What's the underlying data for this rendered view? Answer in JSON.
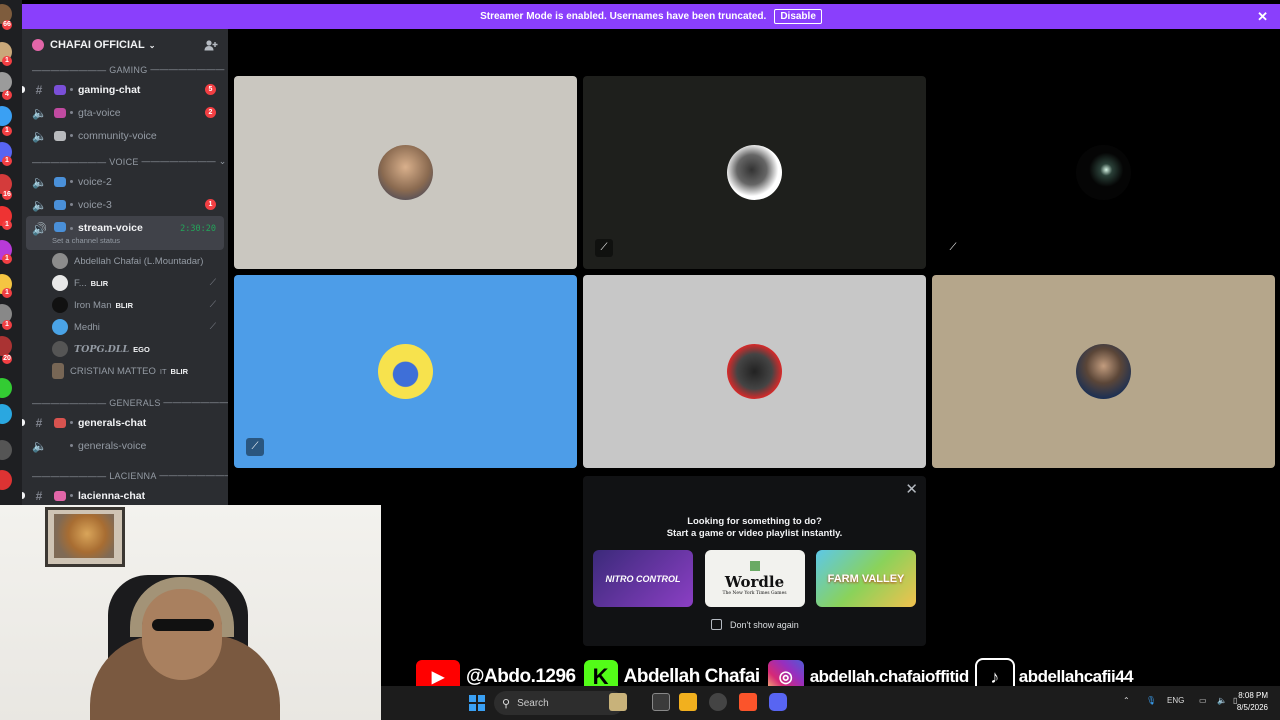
{
  "banner": {
    "message": "Streamer Mode is enabled. Usernames have been truncated.",
    "disable_label": "Disable",
    "close_label": "✕"
  },
  "server": {
    "name": "CHAFAI OFFICIAL",
    "chevron": "⌄",
    "invite_icon": "add-member-icon"
  },
  "rail_badges": [
    "66",
    "1",
    "4",
    "1",
    "1",
    "16",
    "1",
    "1",
    "1",
    "1",
    "1",
    "20",
    "9",
    "6",
    "5",
    "1",
    "4",
    "1"
  ],
  "categories": {
    "gaming": "GAMING",
    "voice": "VOICE",
    "generals": "GENERALS",
    "lacienna": "LACIENNA"
  },
  "channels": {
    "gaming_chat": {
      "name": "gaming-chat",
      "badge": "5"
    },
    "gta_voice": {
      "name": "gta-voice",
      "badge": "2"
    },
    "community_voice": {
      "name": "community-voice"
    },
    "voice_2": {
      "name": "voice-2"
    },
    "voice_3": {
      "name": "voice-3",
      "badge": "1"
    },
    "stream_voice": {
      "name": "stream-voice",
      "timer": "2:30:20",
      "status": "Set a channel status"
    },
    "generals_chat": {
      "name": "generals-chat"
    },
    "generals_voice": {
      "name": "generals-voice"
    },
    "lacienna_chat": {
      "name": "lacienna-chat"
    }
  },
  "members": [
    {
      "name": "Abdellah Chafai (L.Mountadar)",
      "tag": ""
    },
    {
      "name": "F...",
      "tag": "BLIR"
    },
    {
      "name": "Iron Man",
      "tag": "BLIR"
    },
    {
      "name": "Medhi",
      "tag": ""
    },
    {
      "name": "TOPG.DLL",
      "tag": "EGO"
    },
    {
      "name": "CRISTIAN MATTEO",
      "tag": "BLIR",
      "suffix": "IT"
    }
  ],
  "activity": {
    "title_line1": "Looking for something to do?",
    "title_line2": "Start a game or video playlist instantly.",
    "cards": [
      "NITRO CONTROL",
      "Wordle",
      "FARM VALLEY"
    ],
    "wordle_sub": "The New York Times Games",
    "dont_show": "Don't show again"
  },
  "socials": {
    "youtube": "@Abdo.1296",
    "kick": "Abdellah Chafai",
    "instagram": "abdellah.chafaioffitid",
    "tiktok": "abdellahcafii44"
  },
  "taskbar": {
    "search_placeholder": "Search",
    "lang": "ENG",
    "time": "8:08 PM",
    "date": "8/5/2026"
  },
  "colors": {
    "banner": "#8a3ffc",
    "sidebar": "#2b2d31",
    "live_green": "#23a55a",
    "badge_red": "#f23f43"
  }
}
